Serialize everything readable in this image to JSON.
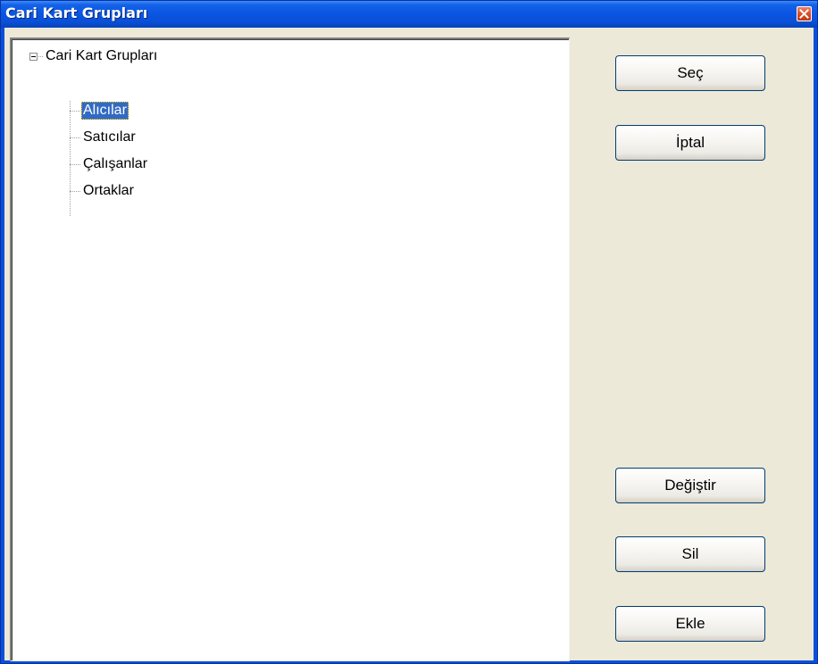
{
  "window": {
    "title": "Cari Kart Grupları"
  },
  "tree": {
    "root_label": "Cari Kart Grupları",
    "root_expanded": true,
    "children": [
      {
        "label": "Alıcılar",
        "selected": true
      },
      {
        "label": "Satıcılar",
        "selected": false
      },
      {
        "label": "Çalışanlar",
        "selected": false
      },
      {
        "label": "Ortaklar",
        "selected": false
      }
    ]
  },
  "buttons": {
    "select": "Seç",
    "cancel": "İptal",
    "edit": "Değiştir",
    "delete": "Sil",
    "add": "Ekle"
  },
  "icons": {
    "close": "close-icon",
    "expander": "collapse-minus-icon"
  },
  "colors": {
    "titlebar": "#0a50d8",
    "client_bg": "#ece9d8",
    "selection": "#316ac5",
    "close_button": "#d84a20",
    "button_border": "#003c74"
  }
}
